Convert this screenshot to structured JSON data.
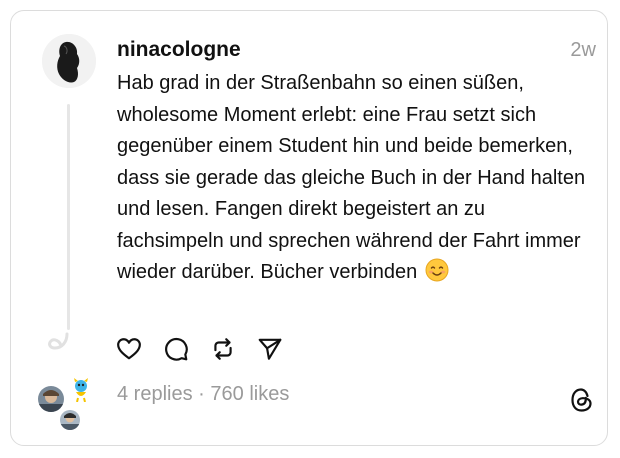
{
  "post": {
    "username": "ninacologne",
    "time": "2w",
    "text": "Hab grad in der Straßenbahn so einen süßen, wholesome Moment erlebt: eine  Frau setzt sich gegenüber einem Student hin und beide bemerken, dass sie gerade das gleiche Buch in der Hand halten und lesen. Fangen direkt begeistert an zu fachsimpeln und sprechen während der Fahrt immer wieder darüber. Bücher verbinden",
    "emoji_icon": "smiling-face-emoji"
  },
  "actions": {
    "like_icon": "heart-icon",
    "reply_icon": "comment-icon",
    "repost_icon": "repost-icon",
    "share_icon": "send-icon"
  },
  "stats": {
    "replies": "4 replies",
    "separator": " · ",
    "likes": "760 likes"
  },
  "colors": {
    "text": "#111111",
    "muted": "#9a9a9a",
    "border": "#dcdcdc",
    "thread_line": "#e6e6e6"
  }
}
